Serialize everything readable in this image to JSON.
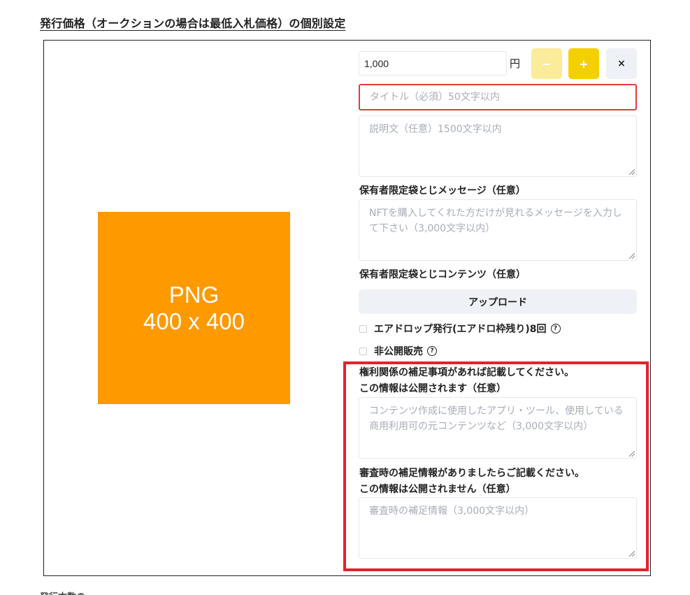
{
  "section_heading": "発行価格（オークションの場合は最低入札価格）の個別設定",
  "preview": {
    "line1": "PNG",
    "line2": "400 x 400"
  },
  "price": {
    "value": "1,000",
    "unit": "円"
  },
  "buttons": {
    "minus": "−",
    "plus": "+",
    "close": "×"
  },
  "title_field": {
    "placeholder": "タイトル（必須）50文字以内"
  },
  "description_field": {
    "placeholder": "説明文（任意）1500文字以内"
  },
  "holder_message": {
    "label": "保有者限定袋とじメッセージ（任意）",
    "placeholder": "NFTを購入してくれた方だけが見れるメッセージを入力して下さい（3,000文字以内）"
  },
  "holder_content": {
    "label": "保有者限定袋とじコンテンツ（任意）",
    "upload_label": "アップロード"
  },
  "airdrop": {
    "label": "エアドロップ発行(エアドロ枠残り)8回",
    "help": "?"
  },
  "private_sale": {
    "label": "非公開販売",
    "help": "?"
  },
  "rights_info": {
    "label_line1": "権利関係の補足事項があれば記載してください。",
    "label_line2": "この情報は公開されます（任意）",
    "placeholder": "コンテンツ作成に使用したアプリ・ツール、使用している商用利用可の元コンテンツなど（3,000文字以内）"
  },
  "review_info": {
    "label_line1": "審査時の補足情報がありましたらご記載ください。",
    "label_line2": "この情報は公開されません（任意）",
    "placeholder": "審査時の補足情報（3,000文字以内）"
  },
  "footer_text": "発行本数の"
}
